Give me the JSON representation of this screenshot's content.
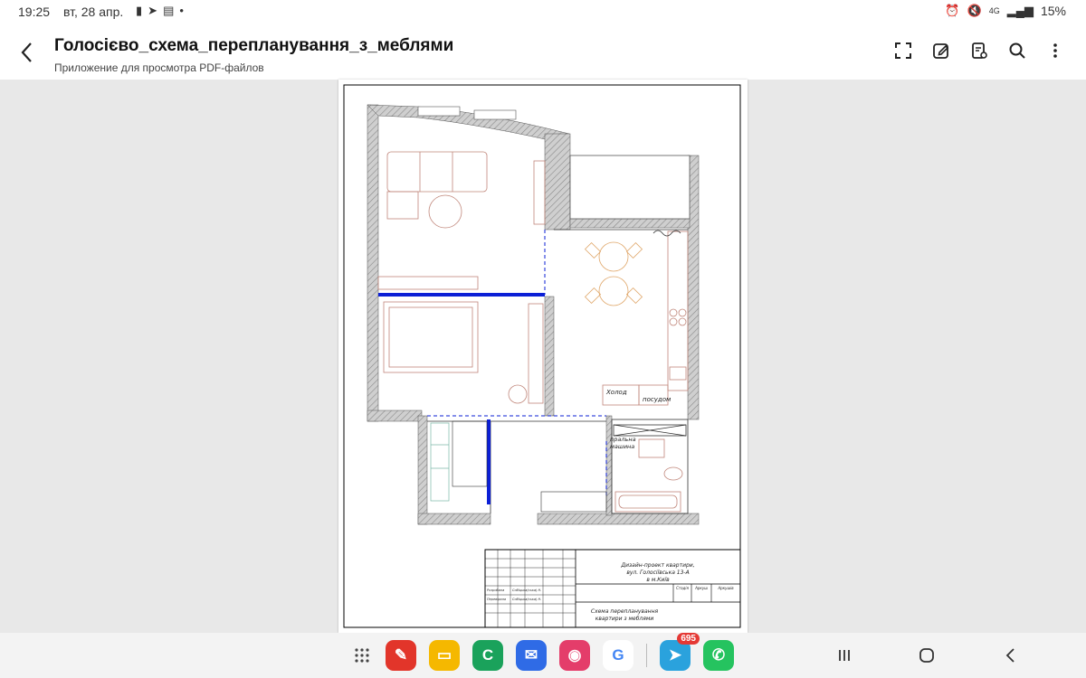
{
  "status_bar": {
    "time": "19:25",
    "date": "вт, 28 апр.",
    "notification_icons": [
      "battery-saver-icon",
      "telegram-icon",
      "calendar-icon"
    ],
    "network": "4G",
    "battery": "15%"
  },
  "app_bar": {
    "title": "Голосієво_схема_перепланування_з_меблями",
    "subtitle": "Приложение для просмотра PDF-файлов",
    "actions": [
      "expand-icon",
      "edit-icon",
      "document-settings-icon",
      "search-icon",
      "more-icon"
    ]
  },
  "document": {
    "labels": {
      "fridge": "Холод",
      "dishwasher": "посудом",
      "washer_line1": "пральна",
      "washer_line2": "машина"
    },
    "title_block": {
      "project_line1": "Дизайн-проект квартири,",
      "project_line2": "вул. Голосіївська 13-А",
      "project_line3": "в м.Київ",
      "sheet_title_line1": "Схема перепланування",
      "sheet_title_line2": "квартири з меблями",
      "col_stage": "Стадія",
      "col_sheet": "Аркуш",
      "col_sheets": "Аркушів",
      "role_1": "Розробила",
      "name_1": "Собіцька(ська) Н.",
      "role_2": "Перевірила",
      "name_2": "Собіцька(ська) Н."
    }
  },
  "dock": {
    "apps": [
      {
        "name": "notes-app-icon",
        "color": "#e2352a",
        "glyph": "✎"
      },
      {
        "name": "files-app-icon",
        "color": "#f5b800",
        "glyph": "▭"
      },
      {
        "name": "phone-app-icon",
        "color": "#1aa25b",
        "glyph": "C"
      },
      {
        "name": "messages-app-icon",
        "color": "#2f6be6",
        "glyph": "💬"
      },
      {
        "name": "camera-app-icon",
        "color": "#e43d6a",
        "glyph": "◉"
      },
      {
        "name": "google-app-icon",
        "color": "#ffffff",
        "glyph": "G"
      },
      {
        "name": "telegram-app-icon",
        "color": "#2aa2dd",
        "glyph": "➤"
      },
      {
        "name": "whatsapp-app-icon",
        "color": "#25c35f",
        "glyph": "✆"
      }
    ],
    "telegram_badge": "695"
  }
}
